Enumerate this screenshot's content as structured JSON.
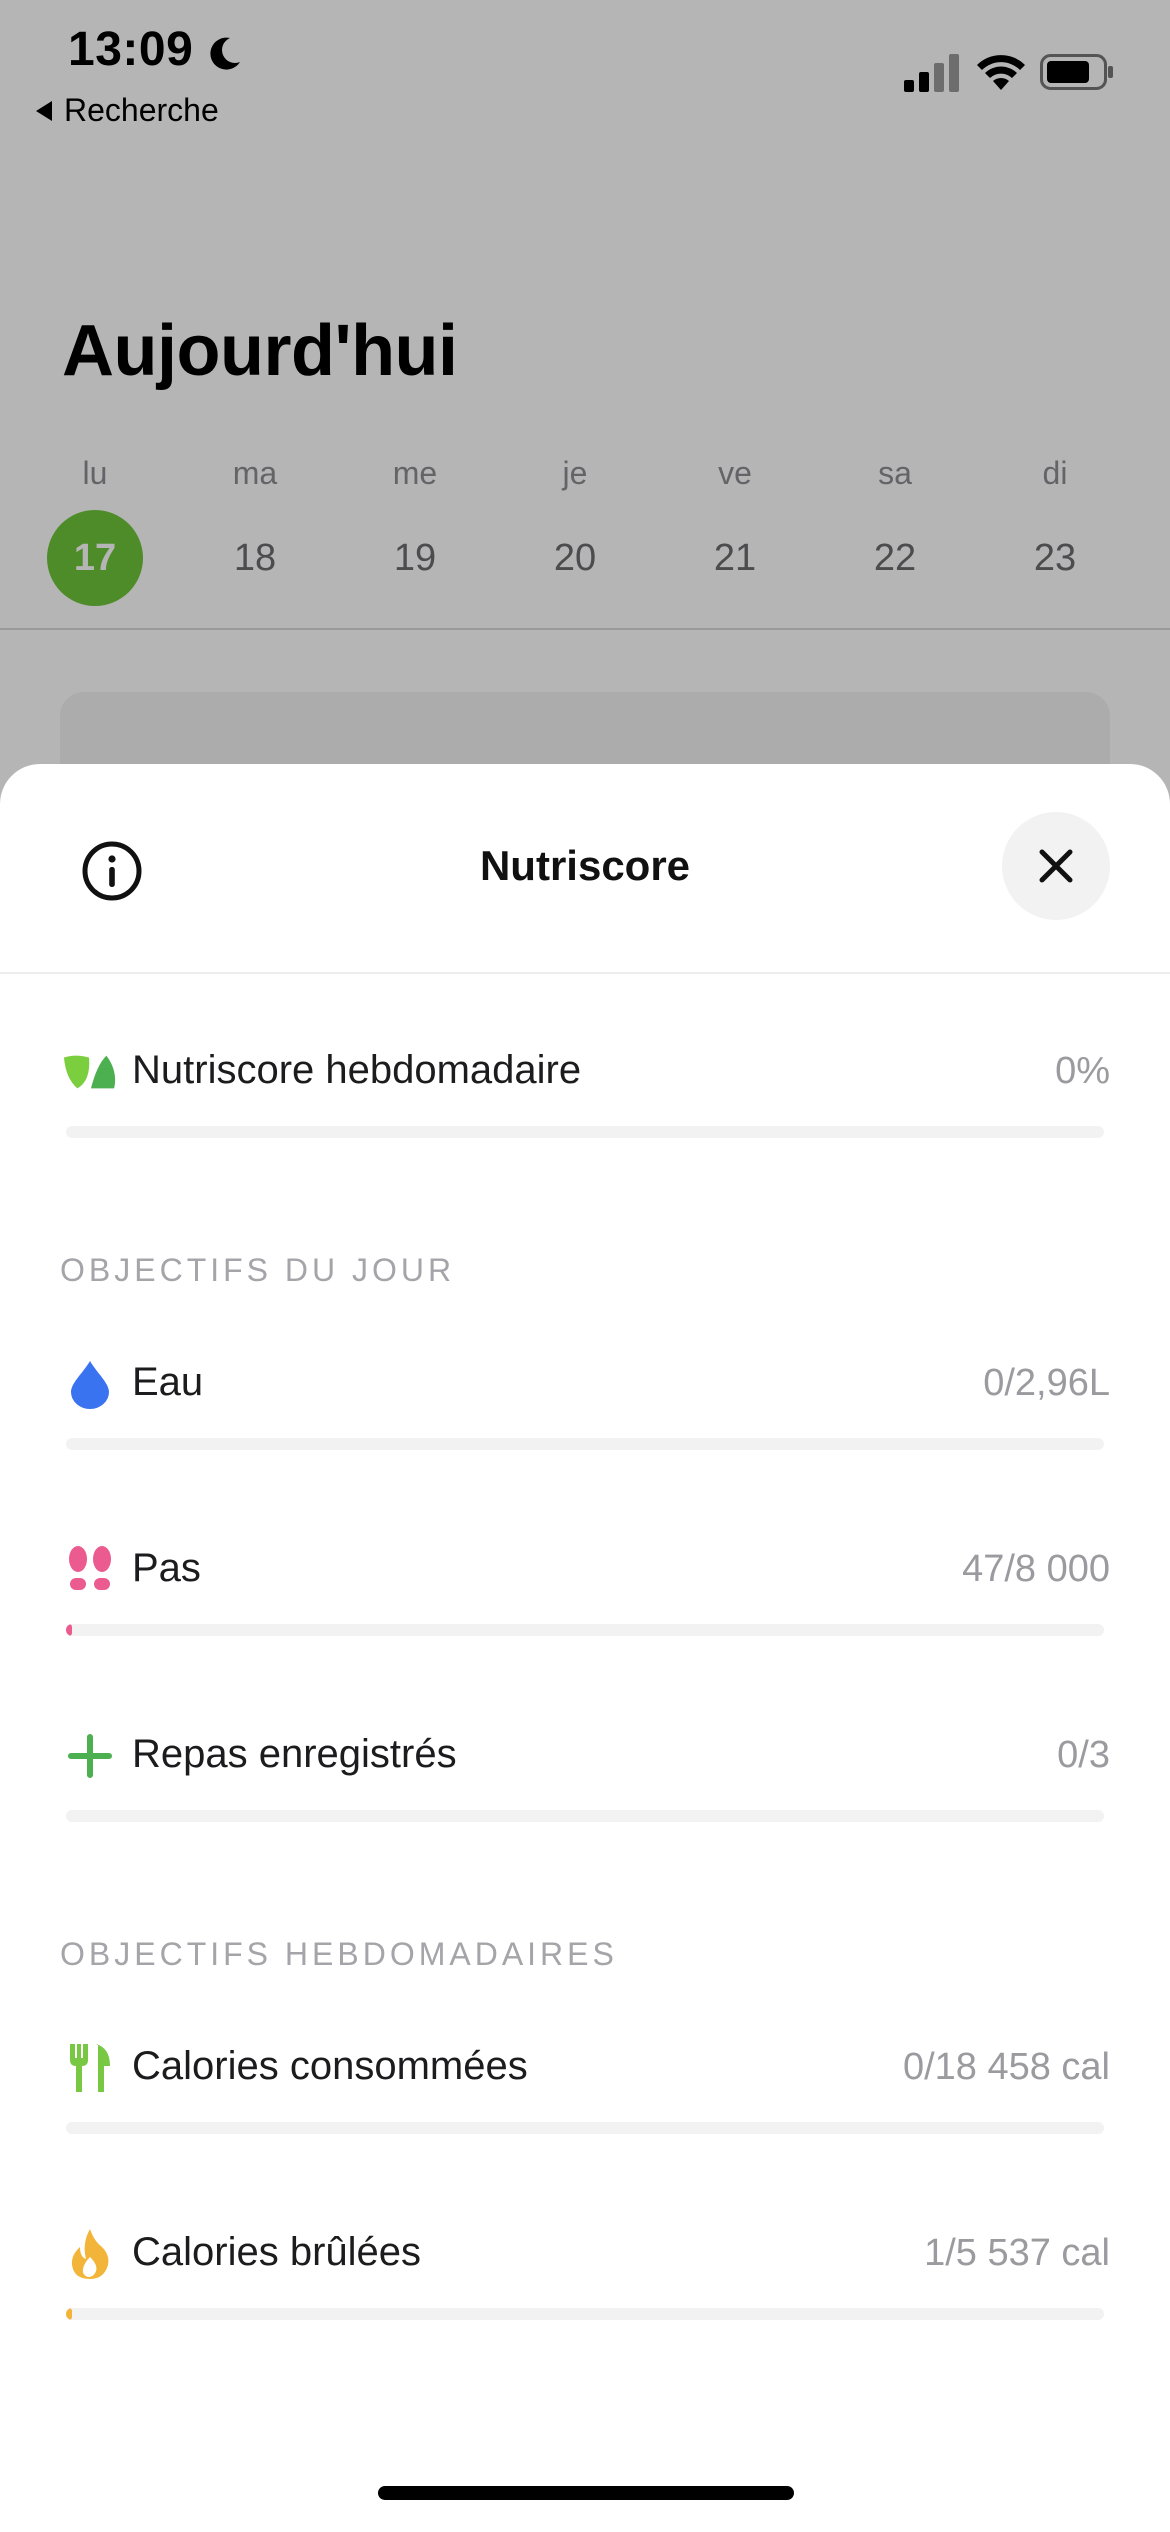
{
  "status_bar": {
    "time": "13:09",
    "back_app_label": "Recherche"
  },
  "background": {
    "title": "Aujourd'hui",
    "week": [
      {
        "day": "lu",
        "date": "17",
        "selected": true
      },
      {
        "day": "ma",
        "date": "18",
        "selected": false
      },
      {
        "day": "me",
        "date": "19",
        "selected": false
      },
      {
        "day": "je",
        "date": "20",
        "selected": false
      },
      {
        "day": "ve",
        "date": "21",
        "selected": false
      },
      {
        "day": "sa",
        "date": "22",
        "selected": false
      },
      {
        "day": "di",
        "date": "23",
        "selected": false
      }
    ],
    "accent_color": "#6fc53b"
  },
  "sheet": {
    "title": "Nutriscore",
    "info_icon": "info-circle-icon",
    "close_icon": "close-icon",
    "weekly_score": {
      "label": "Nutriscore hebdomadaire",
      "value": "0%",
      "progress": 0,
      "icon": "leaves-icon",
      "color": "#6fc53b"
    },
    "daily_section": {
      "header": "OBJECTIFS DU JOUR",
      "items": [
        {
          "label": "Eau",
          "value": "0/2,96L",
          "progress": 0,
          "icon": "water-drop-icon",
          "color": "#3a73f0"
        },
        {
          "label": "Pas",
          "value": "47/8 000",
          "progress": 0.006,
          "icon": "footsteps-icon",
          "color": "#ec5b8f"
        },
        {
          "label": "Repas enregistrés",
          "value": "0/3",
          "progress": 0,
          "icon": "plus-icon",
          "color": "#4caf50"
        }
      ]
    },
    "weekly_section": {
      "header": "OBJECTIFS HEBDOMADAIRES",
      "items": [
        {
          "label": "Calories consommées",
          "value": "0/18 458 cal",
          "progress": 0,
          "icon": "fork-knife-icon",
          "color": "#79c843"
        },
        {
          "label": "Calories brûlées",
          "value": "1/5 537 cal",
          "progress": 0.0002,
          "icon": "flame-icon",
          "color": "#f2b53a"
        }
      ]
    }
  }
}
